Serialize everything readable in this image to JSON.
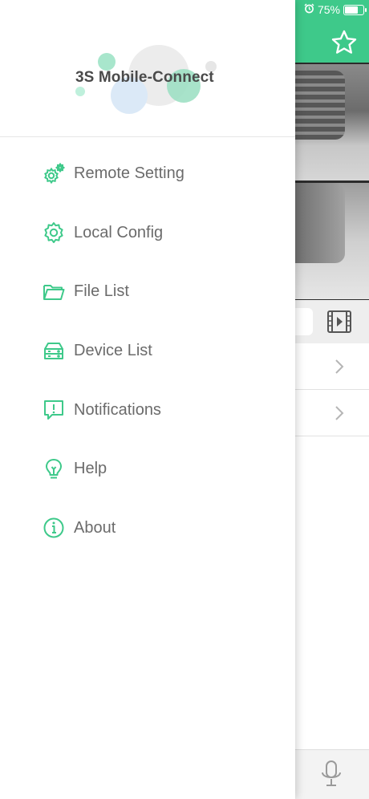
{
  "status_bar": {
    "battery_text": "75%",
    "battery_level": 0.75,
    "alarm_icon": "alarm-clock-icon"
  },
  "app": {
    "brand_color": "#3ec98a",
    "top_bar": {
      "action_icon": "star-icon"
    },
    "controls": {
      "action_icon": "film-play-icon"
    },
    "list_rows": [
      {
        "icon": "chevron-right-icon"
      },
      {
        "icon": "chevron-right-icon"
      }
    ],
    "bottom_bar": {
      "action_icon": "microphone-icon"
    }
  },
  "drawer": {
    "logo_text": "3S Mobile-Connect",
    "menu_items": [
      {
        "label": "Remote Setting",
        "icon": "gears-icon"
      },
      {
        "label": "Local Config",
        "icon": "gear-icon"
      },
      {
        "label": "File List",
        "icon": "folder-icon"
      },
      {
        "label": "Device List",
        "icon": "server-icon"
      },
      {
        "label": "Notifications",
        "icon": "alert-message-icon"
      },
      {
        "label": "Help",
        "icon": "lightbulb-icon"
      },
      {
        "label": "About",
        "icon": "info-icon"
      }
    ],
    "accent_color": "#3ec98a",
    "text_color": "#6b6b6b"
  }
}
